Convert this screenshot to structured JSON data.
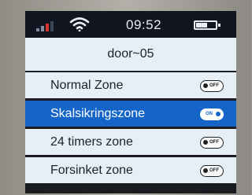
{
  "status": {
    "time": "09:52",
    "signal_icon": "signal-weak-icon",
    "wifi_icon": "wifi-icon",
    "battery_icon": "battery-icon",
    "battery_level": 0.65
  },
  "title": "door~05",
  "zones": [
    {
      "label": "Normal Zone",
      "toggle": "OFF",
      "selected": false
    },
    {
      "label": "Skalsikringszone",
      "toggle": "ON",
      "selected": true
    },
    {
      "label": "24 timers zone",
      "toggle": "OFF",
      "selected": false
    },
    {
      "label": "Forsinket zone",
      "toggle": "OFF",
      "selected": false
    }
  ],
  "colors": {
    "selected_row": "#1565c9",
    "row_background": "#e6eef6",
    "status_bar": "#10151f"
  }
}
